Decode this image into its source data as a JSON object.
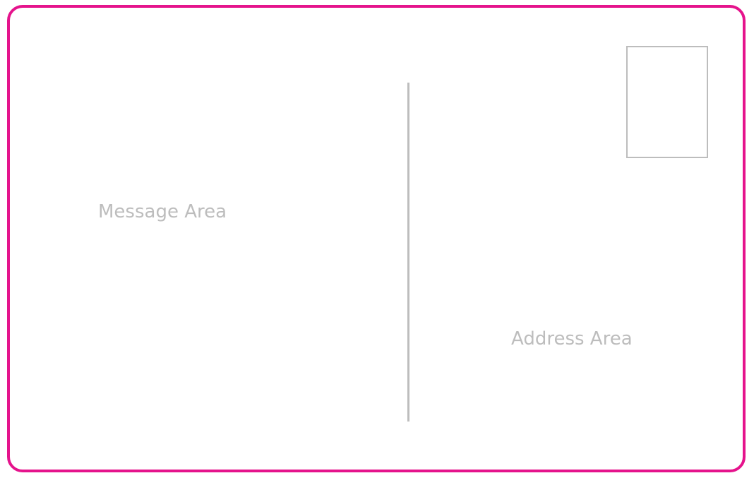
{
  "postcard": {
    "message_label": "Message Area",
    "address_label": "Address Area"
  },
  "colors": {
    "border": "#e5138c",
    "guide": "#bdbdbd",
    "label": "#bdbdbd"
  }
}
